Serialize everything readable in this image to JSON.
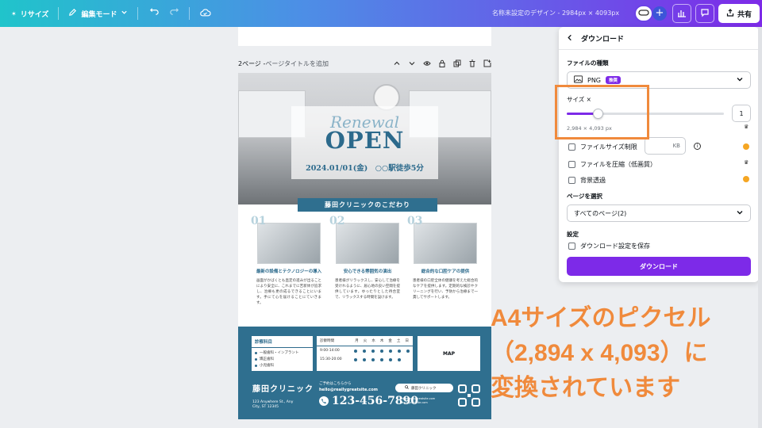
{
  "topbar": {
    "resize_label": "リサイズ",
    "edit_mode_label": "編集モード",
    "doc_title": "名称未設定のデザイン - 2984px × 4093px",
    "share_label": "共有"
  },
  "canvas": {
    "page_number_label": "2ページ - ",
    "page_title_placeholder": "ページタイトルを追加"
  },
  "flyer": {
    "hero": {
      "renewal": "Renewal",
      "open": "OPEN",
      "date_line": "2024.01/01(金)　○○駅徒歩5分"
    },
    "section_title": "藤田クリニックのこだわり",
    "features": [
      {
        "num": "01",
        "title": "最新の設備とテクノロジーの導入",
        "body": "画面がかばくとも直定の進みが出ることにより安全に、これまでに苦新体が追求し、治療も更の成るできることにいます。手にて心を届けることにていきます。"
      },
      {
        "num": "02",
        "title": "安心できる雰囲気の演出",
        "body": "患者様がリラックスし、安心して治療を受けれるように、居心地の良い空間を提供しています。ゆったりとした待合室で、リラックスする時間を設けます。"
      },
      {
        "num": "03",
        "title": "総合的な口腔ケアの提供",
        "body": "患者様の口腔全体の健康を考えた総合的なケアを提供します。定期的な検診やクリーニングを行い、予防から治療まで一貫してサポートします。"
      }
    ],
    "departments": {
      "title": "診察科目",
      "items": [
        "一般歯科・インプラント",
        "矯正歯科",
        "小児歯科"
      ]
    },
    "schedule": {
      "title": "診察時間",
      "days": [
        "月",
        "火",
        "水",
        "木",
        "金",
        "土",
        "日"
      ],
      "rows": [
        {
          "time": "9:00-14:00",
          "open": [
            true,
            true,
            true,
            true,
            true,
            true,
            true
          ]
        },
        {
          "time": "15:30-20:00",
          "open": [
            true,
            true,
            true,
            true,
            true,
            true,
            false
          ]
        }
      ]
    },
    "map_label": "MAP",
    "clinic_name": "藤田クリニック",
    "address": "123 Anywhere St., Any City, ST 12345",
    "contact_label": "ご予約はこちらから",
    "email": "hello@reallygreatsite.com",
    "phone": "123-456-7890",
    "search_text": "藤田クリニック",
    "web_small_1": "www.reallygreatsite.com",
    "web_small_2": "reallygreatsite.com"
  },
  "download_panel": {
    "title": "ダウンロード",
    "file_type_label": "ファイルの種類",
    "file_type_value": "PNG",
    "file_type_badge": "推奨",
    "size_label": "サイズ ×",
    "size_value": "1",
    "size_fraction": 0.2,
    "dimensions": "2,984 × 4,093 px",
    "limit_size_label": "ファイルサイズ制限",
    "kb_unit": "KB",
    "compress_label": "ファイルを圧縮（低画質）",
    "transparent_label": "背景透過",
    "pages_label": "ページを選択",
    "pages_value": "すべてのページ(2)",
    "settings_label": "設定",
    "save_settings_label": "ダウンロード設定を保存",
    "download_button": "ダウンロード"
  },
  "annotation": {
    "line1": "A4サイズのピクセル",
    "line2": "（2,894 x 4,093）に",
    "line3": "変換されています"
  },
  "colors": {
    "accent_purple": "#7d2ae8",
    "flyer_blue": "#2f6f8f",
    "annotation_orange": "#f08a3c"
  }
}
